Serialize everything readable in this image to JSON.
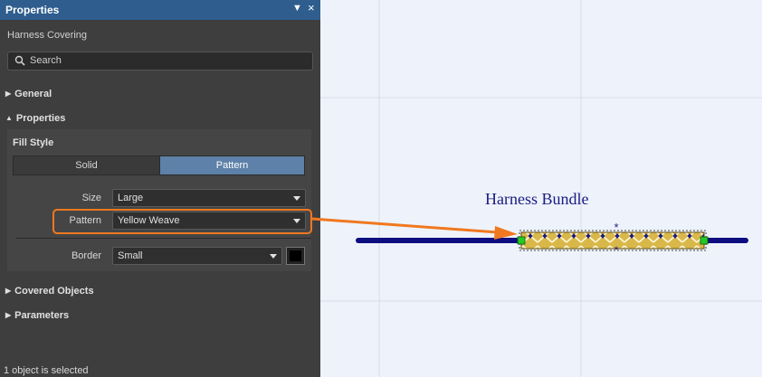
{
  "panel": {
    "title": "Properties",
    "object_type": "Harness Covering",
    "search": {
      "placeholder": "Search"
    },
    "sections": {
      "general": "General",
      "properties": "Properties",
      "covered_objects": "Covered Objects",
      "parameters": "Parameters"
    },
    "fill_style": {
      "label": "Fill Style",
      "options": [
        "Solid",
        "Pattern"
      ],
      "selected": "Pattern"
    },
    "size": {
      "label": "Size",
      "value": "Large"
    },
    "pattern": {
      "label": "Pattern",
      "value": "Yellow Weave"
    },
    "border": {
      "label": "Border",
      "value": "Small",
      "color": "#000000"
    },
    "status": "1 object is selected"
  },
  "canvas": {
    "label": "Harness Bundle",
    "colors": {
      "wire": "#0d0d80",
      "weave": "#d9b84a",
      "highlight": "#f07820",
      "grid": "#d4dde8",
      "handle": "#22cc22"
    }
  }
}
